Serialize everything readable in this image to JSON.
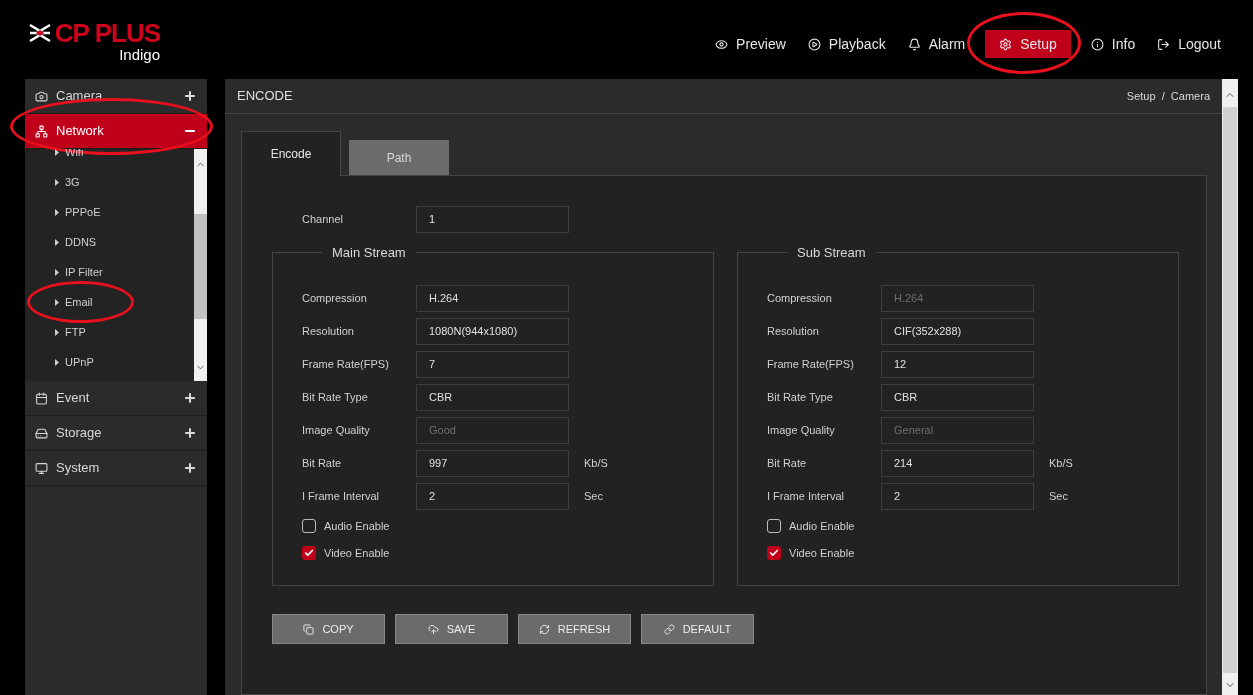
{
  "logo": {
    "brand": "CP PLUS",
    "sub": "Indigo"
  },
  "topnav": [
    {
      "label": "Preview",
      "selected": false,
      "highlighted": false
    },
    {
      "label": "Playback",
      "selected": false,
      "highlighted": false
    },
    {
      "label": "Alarm",
      "selected": false,
      "highlighted": false
    },
    {
      "label": "Setup",
      "selected": true,
      "highlighted": true
    },
    {
      "label": "Info",
      "selected": false,
      "highlighted": false
    },
    {
      "label": "Logout",
      "selected": false,
      "highlighted": false
    }
  ],
  "sidebar": {
    "items": [
      {
        "label": "Camera",
        "expanded": false,
        "selected": false,
        "highlighted": false
      },
      {
        "label": "Network",
        "expanded": true,
        "selected": true,
        "highlighted": true,
        "children": [
          {
            "label": "Wifi",
            "highlighted": false
          },
          {
            "label": "3G",
            "highlighted": false
          },
          {
            "label": "PPPoE",
            "highlighted": false
          },
          {
            "label": "DDNS",
            "highlighted": false
          },
          {
            "label": "IP Filter",
            "highlighted": false
          },
          {
            "label": "Email",
            "highlighted": true
          },
          {
            "label": "FTP",
            "highlighted": false
          },
          {
            "label": "UPnP",
            "highlighted": false
          }
        ]
      },
      {
        "label": "Event",
        "expanded": false,
        "selected": false,
        "highlighted": false
      },
      {
        "label": "Storage",
        "expanded": false,
        "selected": false,
        "highlighted": false
      },
      {
        "label": "System",
        "expanded": false,
        "selected": false,
        "highlighted": false
      }
    ]
  },
  "page": {
    "title": "ENCODE",
    "breadcrumb": "Setup  /  Camera"
  },
  "tabs": [
    {
      "label": "Encode",
      "selected": true
    },
    {
      "label": "Path",
      "selected": false
    }
  ],
  "channel": {
    "label": "Channel",
    "value": "1"
  },
  "streams": [
    {
      "title": "Main Stream",
      "fields": [
        {
          "label": "Compression",
          "value": "H.264",
          "disabled": false
        },
        {
          "label": "Resolution",
          "value": "1080N(944x1080)",
          "disabled": false
        },
        {
          "label": "Frame Rate(FPS)",
          "value": "7",
          "disabled": false
        },
        {
          "label": "Bit Rate Type",
          "value": "CBR",
          "disabled": false
        },
        {
          "label": "Image Quality",
          "value": "Good",
          "disabled": true
        },
        {
          "label": "Bit Rate",
          "value": "997",
          "disabled": false,
          "unit": "Kb/S"
        },
        {
          "label": "I Frame Interval",
          "value": "2",
          "disabled": false,
          "unit": "Sec"
        }
      ],
      "checkboxes": [
        {
          "label": "Audio Enable",
          "checked": false
        },
        {
          "label": "Video Enable",
          "checked": true
        }
      ]
    },
    {
      "title": "Sub Stream",
      "fields": [
        {
          "label": "Compression",
          "value": "H.264",
          "disabled": true
        },
        {
          "label": "Resolution",
          "value": "CIF(352x288)",
          "disabled": false
        },
        {
          "label": "Frame Rate(FPS)",
          "value": "12",
          "disabled": false
        },
        {
          "label": "Bit Rate Type",
          "value": "CBR",
          "disabled": false
        },
        {
          "label": "Image Quality",
          "value": "General",
          "disabled": true
        },
        {
          "label": "Bit Rate",
          "value": "214",
          "disabled": false,
          "unit": "Kb/S"
        },
        {
          "label": "I Frame Interval",
          "value": "2",
          "disabled": false,
          "unit": "Sec"
        }
      ],
      "checkboxes": [
        {
          "label": "Audio Enable",
          "checked": false
        },
        {
          "label": "Video Enable",
          "checked": true
        }
      ]
    }
  ],
  "buttons": [
    {
      "label": "COPY"
    },
    {
      "label": "SAVE"
    },
    {
      "label": "REFRESH"
    },
    {
      "label": "DEFAULT"
    }
  ]
}
